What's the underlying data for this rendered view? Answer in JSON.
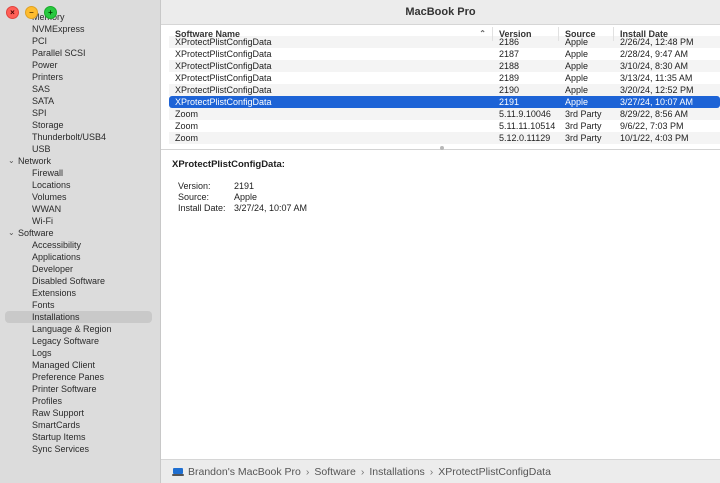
{
  "window": {
    "title": "MacBook Pro"
  },
  "sidebar": {
    "hardware_items": [
      "Memory",
      "NVMExpress",
      "PCI",
      "Parallel SCSI",
      "Power",
      "Printers",
      "SAS",
      "SATA",
      "SPI",
      "Storage",
      "Thunderbolt/USB4",
      "USB"
    ],
    "network_label": "Network",
    "network_items": [
      "Firewall",
      "Locations",
      "Volumes",
      "WWAN",
      "Wi-Fi"
    ],
    "software_label": "Software",
    "software_items": [
      "Accessibility",
      "Applications",
      "Developer",
      "Disabled Software",
      "Extensions",
      "Fonts",
      "Installations",
      "Language & Region",
      "Legacy Software",
      "Logs",
      "Managed Client",
      "Preference Panes",
      "Printer Software",
      "Profiles",
      "Raw Support",
      "SmartCards",
      "Startup Items",
      "Sync Services"
    ],
    "selected": "Installations"
  },
  "table": {
    "headers": {
      "name": "Software Name",
      "version": "Version",
      "source": "Source",
      "date": "Install Date"
    },
    "rows": [
      {
        "name": "XProtectPlistConfigData",
        "version": "2186",
        "source": "Apple",
        "date": "2/26/24, 12:48 PM"
      },
      {
        "name": "XProtectPlistConfigData",
        "version": "2187",
        "source": "Apple",
        "date": "2/28/24, 9:47 AM"
      },
      {
        "name": "XProtectPlistConfigData",
        "version": "2188",
        "source": "Apple",
        "date": "3/10/24, 8:30 AM"
      },
      {
        "name": "XProtectPlistConfigData",
        "version": "2189",
        "source": "Apple",
        "date": "3/13/24, 11:35 AM"
      },
      {
        "name": "XProtectPlistConfigData",
        "version": "2190",
        "source": "Apple",
        "date": "3/20/24, 12:52 PM"
      },
      {
        "name": "XProtectPlistConfigData",
        "version": "2191",
        "source": "Apple",
        "date": "3/27/24, 10:07 AM"
      },
      {
        "name": "Zoom",
        "version": "5.11.9.10046",
        "source": "3rd Party",
        "date": "8/29/22, 8:56 AM"
      },
      {
        "name": "Zoom",
        "version": "5.11.11.10514",
        "source": "3rd Party",
        "date": "9/6/22, 7:03 PM"
      },
      {
        "name": "Zoom",
        "version": "5.12.0.11129",
        "source": "3rd Party",
        "date": "10/1/22, 4:03 PM"
      }
    ],
    "selected_index": 5
  },
  "detail": {
    "title": "XProtectPlistConfigData:",
    "fields": [
      {
        "key": "Version:",
        "value": "2191"
      },
      {
        "key": "Source:",
        "value": "Apple"
      },
      {
        "key": "Install Date:",
        "value": "3/27/24, 10:07 AM"
      }
    ]
  },
  "breadcrumb": [
    "Brandon's MacBook Pro",
    "Software",
    "Installations",
    "XProtectPlistConfigData"
  ],
  "icons": {
    "sort": "chevron-up-icon",
    "computer": "laptop-icon",
    "close": "close-icon",
    "minimize": "minimize-icon",
    "zoom": "zoom-icon"
  }
}
